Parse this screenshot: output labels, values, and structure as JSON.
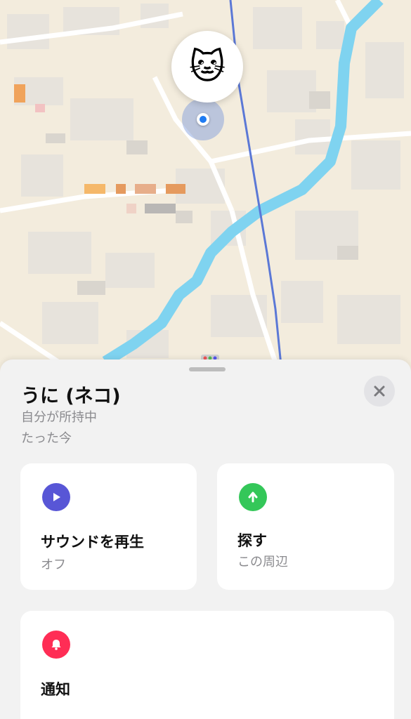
{
  "map": {
    "pin_emoji": "🐱",
    "colors": {
      "land": "#f3ecdd",
      "water": "#7fd3f0",
      "rail": "#5b78d6",
      "accent_blue": "#1f7bf2"
    }
  },
  "item": {
    "name": "うに (ネコ)",
    "owner_status": "自分が所持中",
    "last_seen": "たった今"
  },
  "actions": {
    "play_sound": {
      "label": "サウンドを再生",
      "status": "オフ",
      "icon": "play-icon",
      "color": "#5856d6"
    },
    "find": {
      "label": "探す",
      "status": "この周辺",
      "icon": "arrow-up-icon",
      "color": "#34c759"
    },
    "notifications": {
      "label": "通知",
      "icon": "bell-icon",
      "color": "#ff2d55"
    }
  }
}
